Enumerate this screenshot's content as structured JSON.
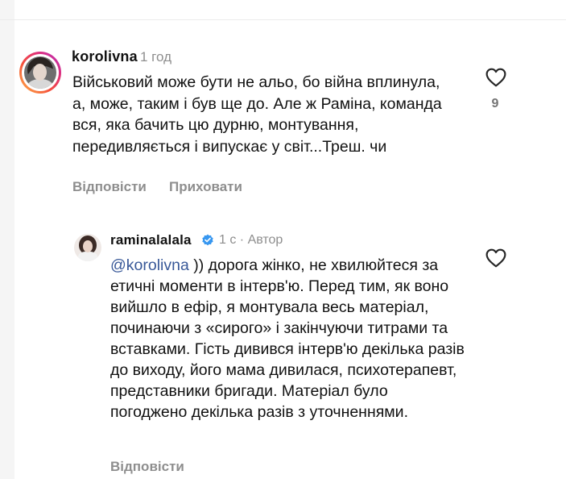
{
  "comments": [
    {
      "username": "korolivna",
      "time": "1 год",
      "text": "Військовий може бути не альо, бо війна вплинула, а, може, таким і був ще до. Але ж Раміна, команда вся, яка бачить цю дурню, монтування, передивляється і випускає у світ...Треш. чи",
      "actions": {
        "reply": "Відповісти",
        "hide": "Приховати"
      },
      "likes": "9",
      "icons": {
        "like": "heart-outline-icon"
      }
    },
    {
      "username": "raminalalala",
      "time": "1 с · Автор",
      "mention": "@korolivna",
      "text": " )) дорога жінко, не хвилюйтеся за етичні моменти в інтерв'ю. Перед тим, як воно вийшло в ефір, я монтувала весь матеріал, починаючи з «сирого» і закінчуючи титрами та вставками. Гість дивився інтерв'ю декілька разів до виходу, його мама дивилася, психотерапевт, представники бригади. Матеріал було погоджено декілька разів з уточненнями.",
      "actions": {
        "reply": "Відповісти"
      },
      "icons": {
        "like": "heart-outline-icon",
        "verified": "verified-badge-icon"
      }
    }
  ],
  "colors": {
    "verified": "#3797f0",
    "muted": "#8e8e8e",
    "mention": "#385898"
  }
}
